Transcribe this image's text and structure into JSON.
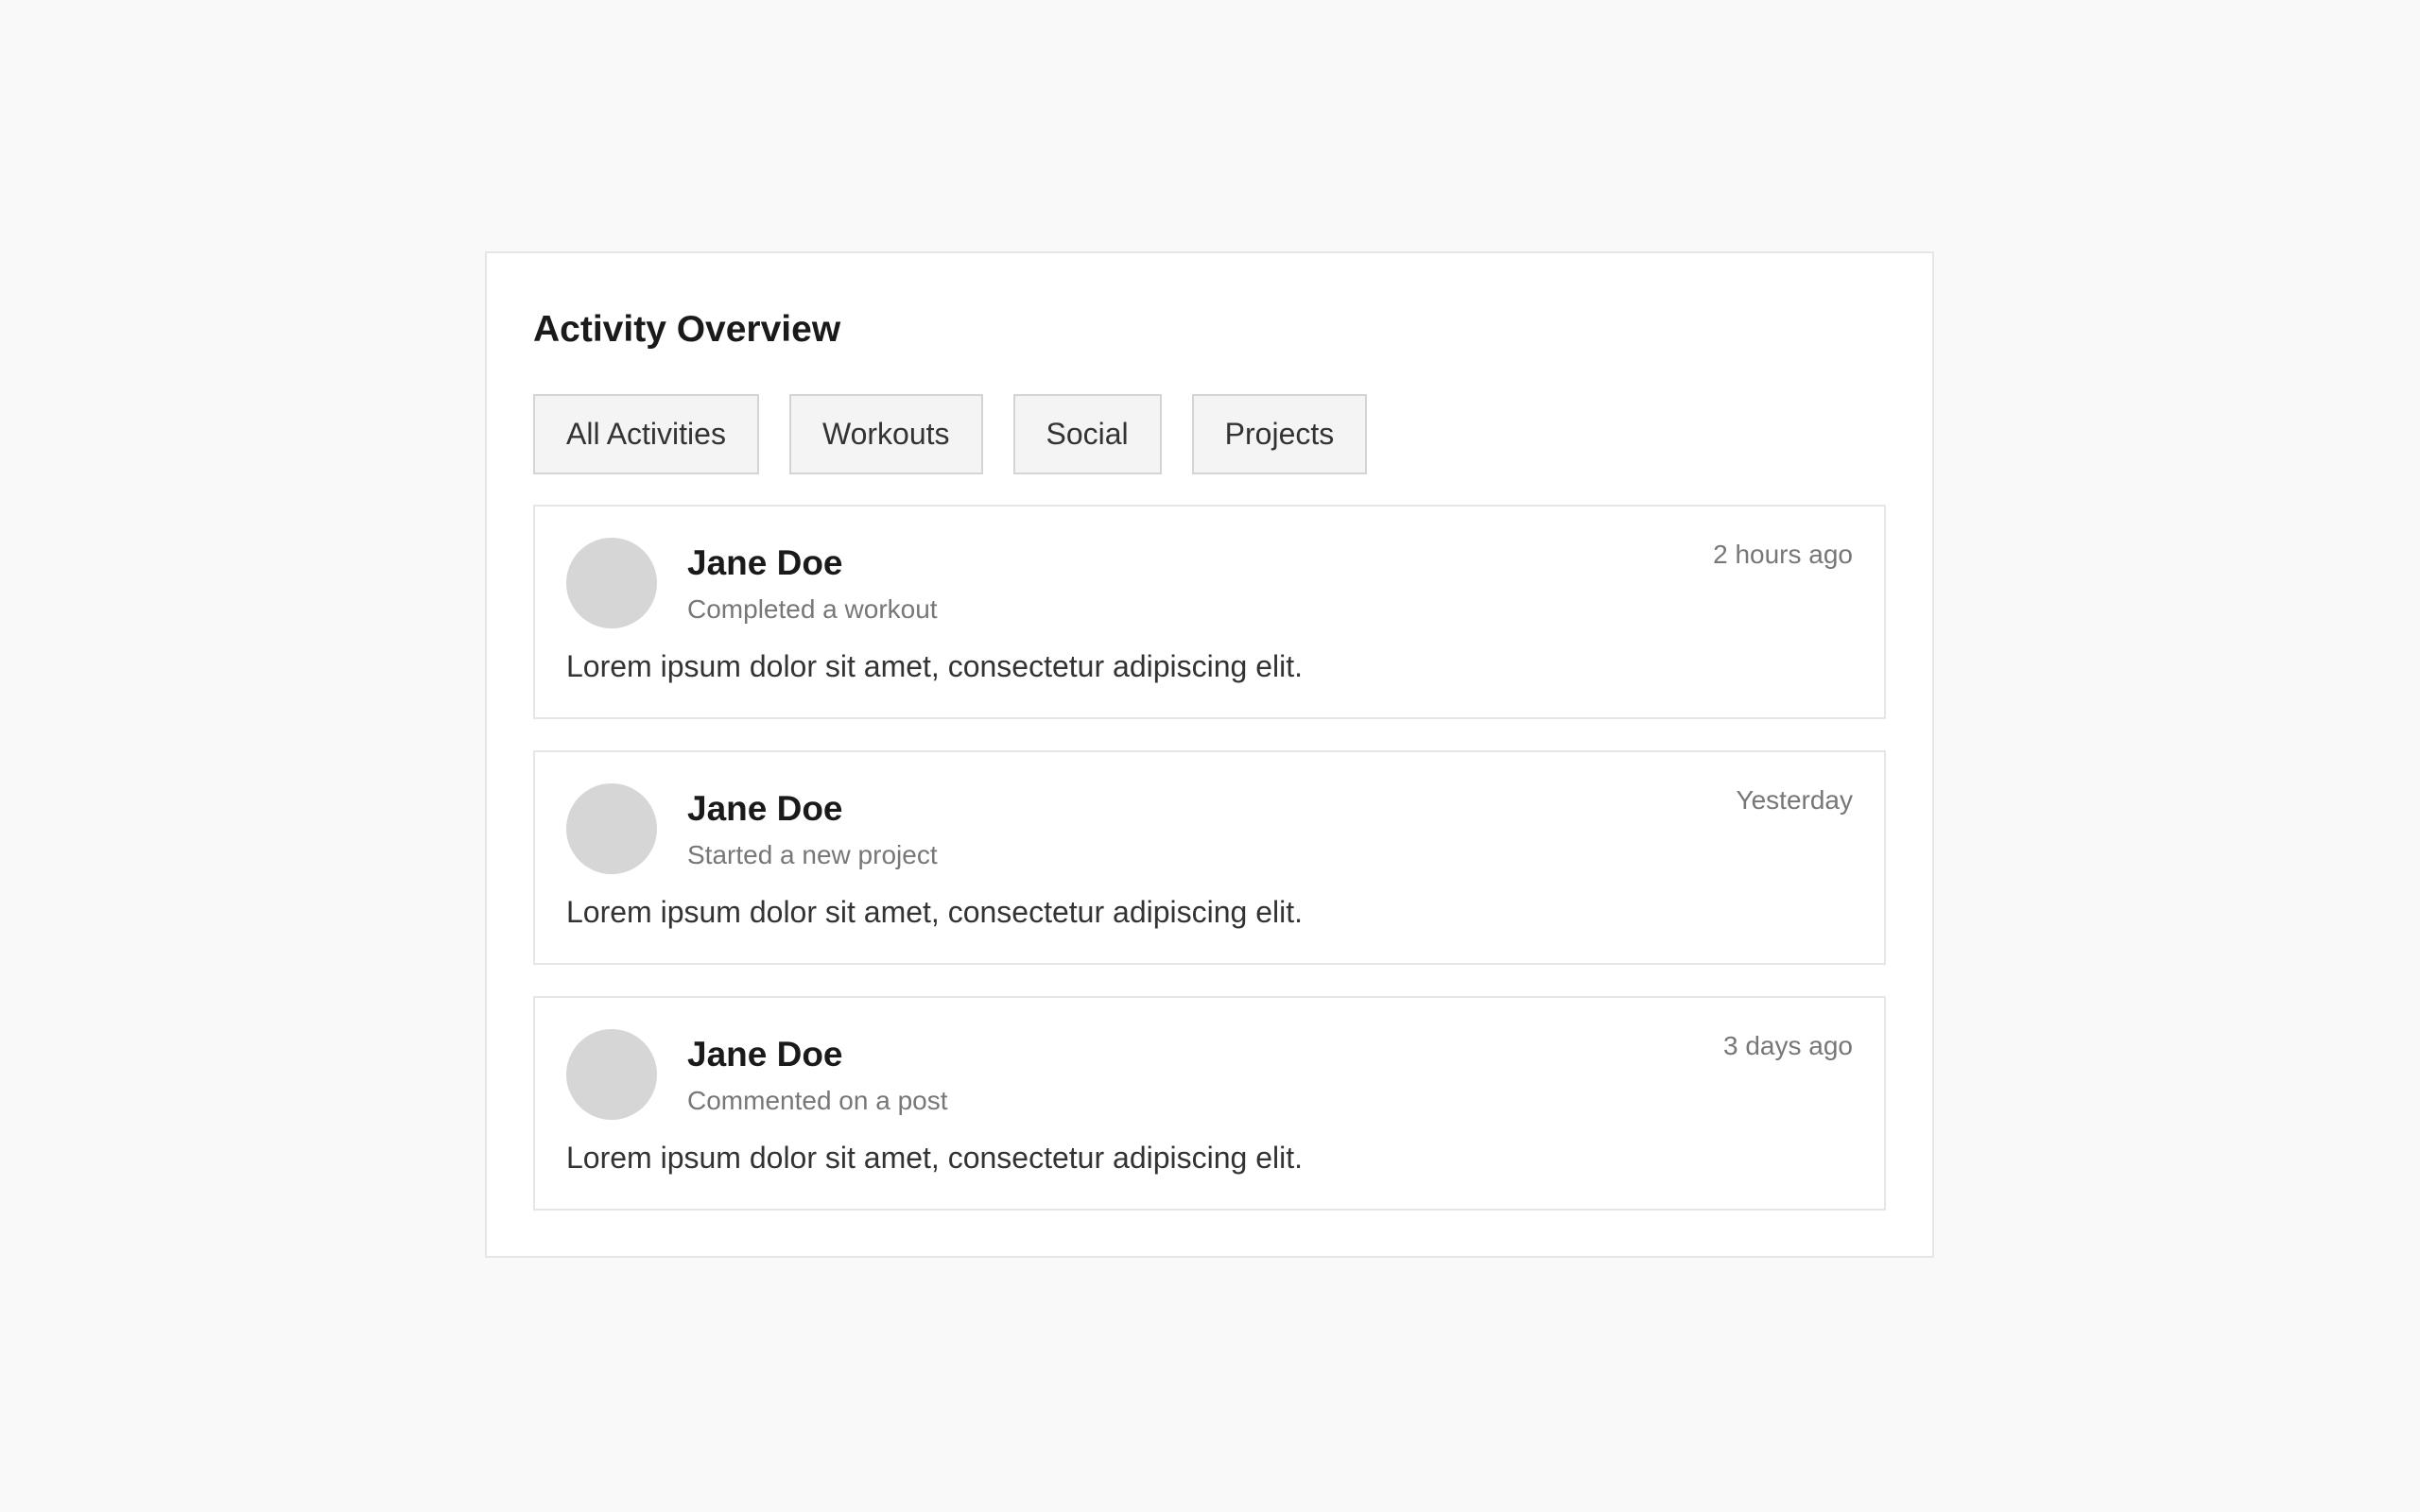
{
  "header": {
    "title": "Activity Overview"
  },
  "filters": [
    {
      "label": "All Activities"
    },
    {
      "label": "Workouts"
    },
    {
      "label": "Social"
    },
    {
      "label": "Projects"
    }
  ],
  "activities": [
    {
      "name": "Jane Doe",
      "action": "Completed a workout",
      "time": "2 hours ago",
      "text": "Lorem ipsum dolor sit amet, consectetur adipiscing elit."
    },
    {
      "name": "Jane Doe",
      "action": "Started a new project",
      "time": "Yesterday",
      "text": "Lorem ipsum dolor sit amet, consectetur adipiscing elit."
    },
    {
      "name": "Jane Doe",
      "action": "Commented on a post",
      "time": "3 days ago",
      "text": "Lorem ipsum dolor sit amet, consectetur adipiscing elit."
    }
  ],
  "colors": {
    "background": "#f9f9f9",
    "panel": "#ffffff",
    "avatar_placeholder": "#d6d6d6",
    "muted_text": "#777777"
  }
}
